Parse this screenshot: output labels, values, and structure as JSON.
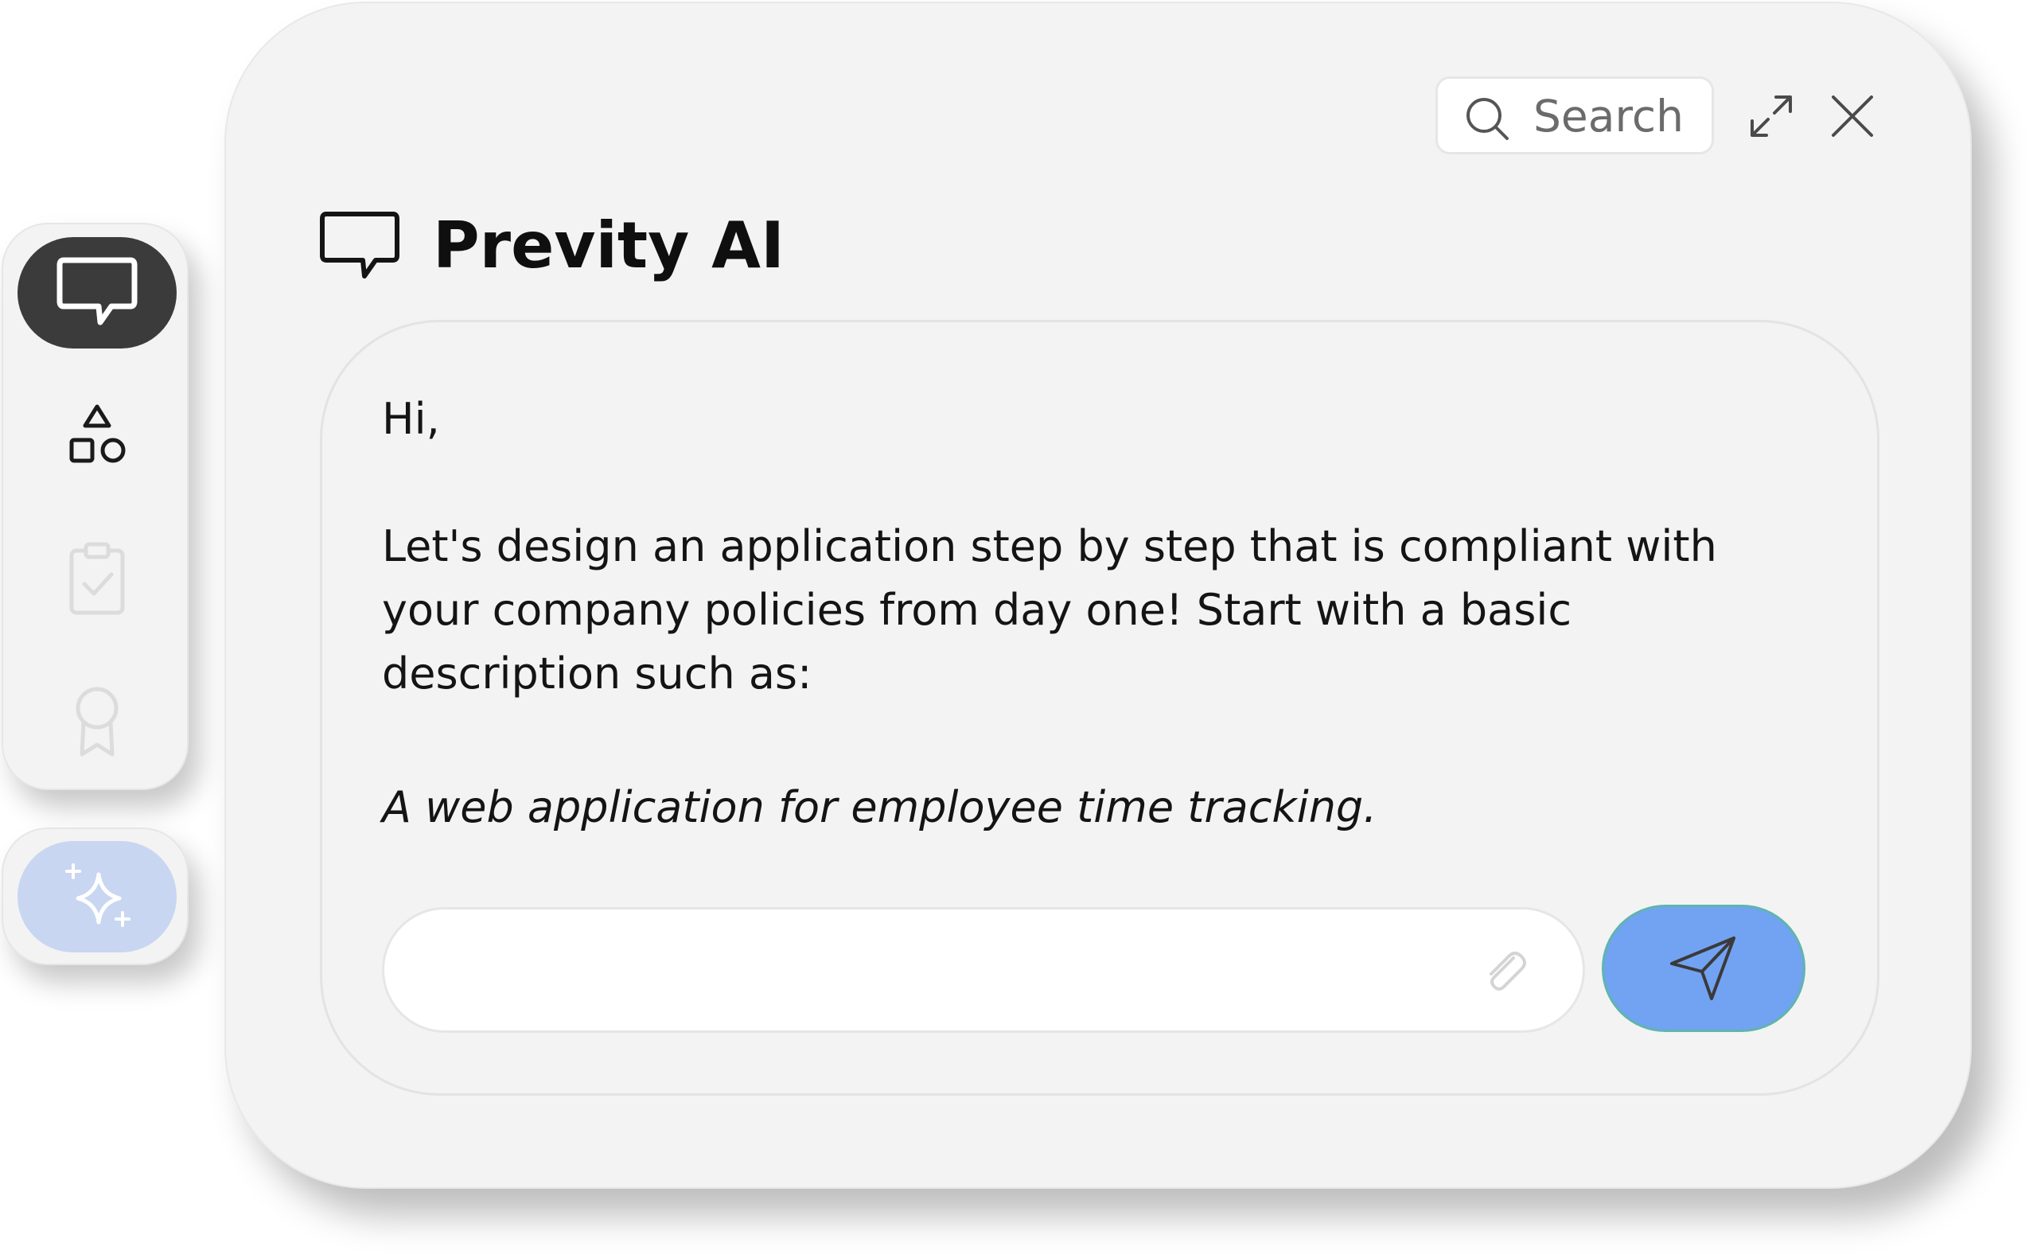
{
  "app": {
    "title": "Previty AI"
  },
  "toolbar": {
    "search_placeholder": "Search",
    "search_icon": "search-icon",
    "expand_icon": "expand-icon",
    "close_icon": "close-icon"
  },
  "sidebar": {
    "items": [
      {
        "icon": "chat-icon",
        "active": true
      },
      {
        "icon": "shapes-icon",
        "active": false
      },
      {
        "icon": "clipboard-check-icon",
        "active": false
      },
      {
        "icon": "award-icon",
        "active": false
      }
    ],
    "ai_button_icon": "sparkles-icon"
  },
  "conversation": {
    "greeting": "Hi,",
    "intro": "Let's design an application step by step that is compliant with your company policies from day one! Start with a basic description such as:",
    "example": "A web application for employee time tracking."
  },
  "composer": {
    "value": "",
    "placeholder": "",
    "attach_icon": "paperclip-icon",
    "send_icon": "send-icon"
  },
  "colors": {
    "window_bg": "#f3f3f3",
    "active_rail_bg": "#3b3b3b",
    "ai_button_bg": "#c8d6f2",
    "send_button_bg": "#72a2f2",
    "send_button_border": "#5fb5ad",
    "text": "#141414"
  }
}
